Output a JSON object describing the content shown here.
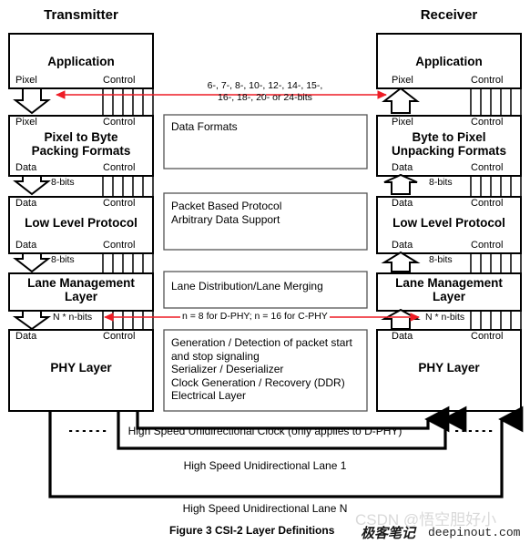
{
  "figure": {
    "caption": "Figure 3 CSI-2 Layer Definitions",
    "columns": {
      "transmitter_header": "Transmitter",
      "receiver_header": "Receiver"
    }
  },
  "ports": {
    "pixel": "Pixel",
    "control": "Control",
    "data": "Data"
  },
  "annotations": {
    "bit_widths": "6-, 7-, 8-, 10-, 12-, 14-, 15-,\n16-, 18-, 20- or 24-bits",
    "eight_bits": "8-bits",
    "n_times_n_bits": "N * n-bits",
    "phy_n_note": "n =  8  for D-PHY; n = 16 for C-PHY"
  },
  "transmitter": {
    "layers": [
      {
        "name": "Application",
        "top_ports": [],
        "bottom_ports": [
          "Pixel",
          "Control"
        ]
      },
      {
        "name": "Pixel to Byte\nPacking Formats",
        "top_ports": [
          "Pixel",
          "Control"
        ],
        "bottom_ports": [
          "Data",
          "Control"
        ]
      },
      {
        "name": "Low Level Protocol",
        "top_ports": [
          "Data",
          "Control"
        ],
        "bottom_ports": [
          "Data",
          "Control"
        ]
      },
      {
        "name": "Lane Management\nLayer",
        "top_ports": [],
        "bottom_ports": []
      },
      {
        "name": "PHY Layer",
        "top_ports": [
          "Data",
          "Control"
        ],
        "bottom_ports": []
      }
    ]
  },
  "receiver": {
    "layers": [
      {
        "name": "Application",
        "top_ports": [],
        "bottom_ports": [
          "Pixel",
          "Control"
        ]
      },
      {
        "name": "Byte to Pixel\nUnpacking Formats",
        "top_ports": [
          "Pixel",
          "Control"
        ],
        "bottom_ports": [
          "Data",
          "Control"
        ]
      },
      {
        "name": "Low Level Protocol",
        "top_ports": [
          "Data",
          "Control"
        ],
        "bottom_ports": [
          "Data",
          "Control"
        ]
      },
      {
        "name": "Lane Management\nLayer",
        "top_ports": [],
        "bottom_ports": []
      },
      {
        "name": "PHY Layer",
        "top_ports": [
          "Data",
          "Control"
        ],
        "bottom_ports": []
      }
    ]
  },
  "middle_boxes": [
    {
      "id": "data-formats",
      "text": "Data Formats"
    },
    {
      "id": "protocol",
      "text": "Packet Based Protocol\nArbitrary Data Support"
    },
    {
      "id": "lane-distribution",
      "text": "Lane Distribution/Lane Merging"
    },
    {
      "id": "phy-details",
      "text": "Generation / Detection of packet start\nand stop signaling\nSerializer / Deserializer\nClock Generation / Recovery (DDR)\nElectrical Layer"
    }
  ],
  "links": [
    {
      "id": "clock",
      "label": "High Speed Unidirectional Clock (only applies to D-PHY)"
    },
    {
      "id": "lane1",
      "label": "High Speed Unidirectional Lane 1"
    },
    {
      "id": "laneN",
      "label": "High Speed Unidirectional Lane N"
    }
  ],
  "watermark": {
    "csdn": "CSDN @悟空胆好小",
    "brush": "极客笔记",
    "domain": "deepinout.com"
  },
  "colors": {
    "arrow_red": "#ee1c25",
    "stroke": "#000000",
    "background": "#ffffff",
    "watermark_gray": "#d9d9d9"
  }
}
